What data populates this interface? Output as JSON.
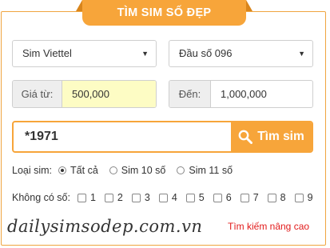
{
  "header": {
    "title": "TÌM SIM SỐ ĐẸP"
  },
  "filters": {
    "network": {
      "selected": "Sim Viettel"
    },
    "prefix": {
      "selected": "Đầu số 096"
    }
  },
  "price": {
    "from_label": "Giá từ:",
    "from_value": "500,000",
    "to_label": "Đến:",
    "to_value": "1,000,000"
  },
  "search": {
    "value": "*1971",
    "button_label": "Tìm sim"
  },
  "sim_type": {
    "label": "Loại sim:",
    "options": [
      "Tất cả",
      "Sim 10 số",
      "Sim 11 số"
    ],
    "selected_index": 0
  },
  "exclude_digits": {
    "label": "Không có số:",
    "digits": [
      "1",
      "2",
      "3",
      "4",
      "5",
      "6",
      "7",
      "8",
      "9"
    ]
  },
  "footer": {
    "logo_text": "dailysimsodep.com.vn",
    "advanced_link": "Tìm kiếm nâng cao"
  },
  "colors": {
    "accent": "#f7a53a",
    "link_red": "#e21b1b",
    "highlight_input": "#fdfcc4"
  },
  "icons": {
    "search": "magnifier-icon",
    "dropdown": "chevron-down-icon"
  }
}
